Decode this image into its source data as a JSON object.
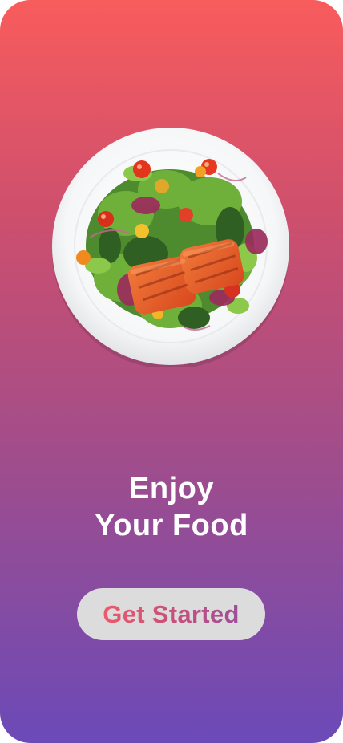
{
  "onboarding": {
    "headline_line1": "Enjoy",
    "headline_line2": "Your Food",
    "cta_label": "Get Started"
  },
  "theme": {
    "gradient_top": "#f85c5c",
    "gradient_bottom": "#6b4ab8",
    "button_bg": "#dcdcdc",
    "text_color": "#ffffff"
  },
  "hero_image": {
    "subject": "salmon-salad-plate"
  }
}
